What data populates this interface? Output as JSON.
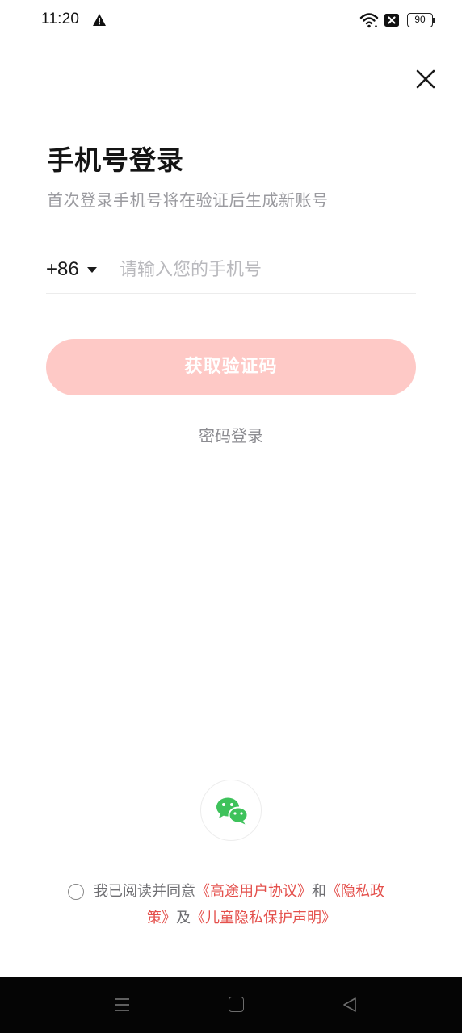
{
  "status_bar": {
    "time": "11:20",
    "battery_level": "90",
    "icons": [
      "warning-icon",
      "wifi-icon",
      "no-sim-icon",
      "battery-icon"
    ]
  },
  "header": {
    "close_icon": "close-icon"
  },
  "main": {
    "title": "手机号登录",
    "subtitle": "首次登录手机号将在验证后生成新账号",
    "country_code": "+86",
    "phone_placeholder": "请输入您的手机号",
    "phone_value": "",
    "get_code_label": "获取验证码",
    "password_login_label": "密码登录"
  },
  "social_login": {
    "wechat_icon": "wechat-icon"
  },
  "agreement": {
    "checked": false,
    "prefix": "我已阅读并同意",
    "user_agreement": "《高途用户协议》",
    "and": "和",
    "privacy_part1": "《隐私政",
    "privacy_part2": "策》",
    "and2": "及",
    "child_privacy": "《儿童隐私保护声明》"
  },
  "colors": {
    "accent_red": "#e4504c",
    "button_disabled": "#fec9c6",
    "wechat_green": "#3ec25b",
    "nav_bar": "#050505"
  },
  "nav_bar": {
    "buttons": [
      "menu-icon",
      "home-icon",
      "back-icon"
    ]
  }
}
